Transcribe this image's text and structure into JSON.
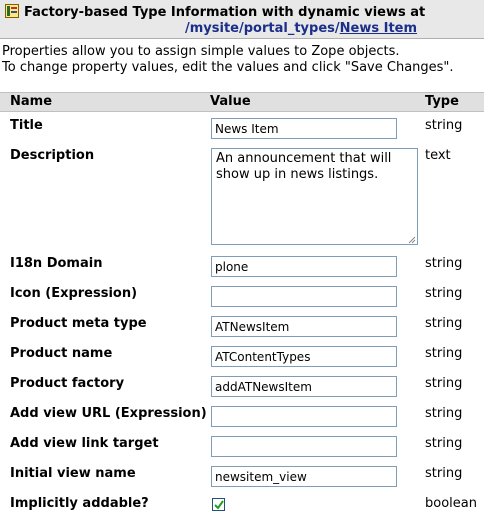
{
  "header": {
    "icon": "factory-type-icon",
    "title": "Factory-based Type Information with dynamic views at",
    "breadcrumb": [
      {
        "label": "/mysite",
        "sep": "/"
      },
      {
        "label": "portal_types",
        "sep": "/"
      },
      {
        "label": "News Item",
        "sep": ""
      }
    ]
  },
  "help": {
    "line1": "Properties allow you to assign simple values to Zope objects.",
    "line2": "To change property values, edit the values and click \"Save Changes\"."
  },
  "columns": {
    "name": "Name",
    "value": "Value",
    "type": "Type"
  },
  "properties": [
    {
      "label": "Title",
      "value": "News Item",
      "type": "string"
    },
    {
      "label": "Description",
      "value": "An announcement that will show up in news listings.",
      "type": "text"
    },
    {
      "label": "I18n Domain",
      "value": "plone",
      "type": "string"
    },
    {
      "label": "Icon (Expression)",
      "value": "",
      "type": "string"
    },
    {
      "label": "Product meta type",
      "value": "ATNewsItem",
      "type": "string"
    },
    {
      "label": "Product name",
      "value": "ATContentTypes",
      "type": "string"
    },
    {
      "label": "Product factory",
      "value": "addATNewsItem",
      "type": "string"
    },
    {
      "label": "Add view URL (Expression)",
      "value": "",
      "type": "string"
    },
    {
      "label": "Add view link target",
      "value": "",
      "type": "string"
    },
    {
      "label": "Initial view name",
      "value": "newsitem_view",
      "type": "string"
    },
    {
      "label": "Implicitly addable?",
      "checked": true,
      "type": "boolean"
    }
  ],
  "colors": {
    "link": "#1a2e8a",
    "header_bg": "#e8e8e8",
    "column_bar_bg": "#e0e0e0",
    "input_border": "#7f9db9"
  }
}
